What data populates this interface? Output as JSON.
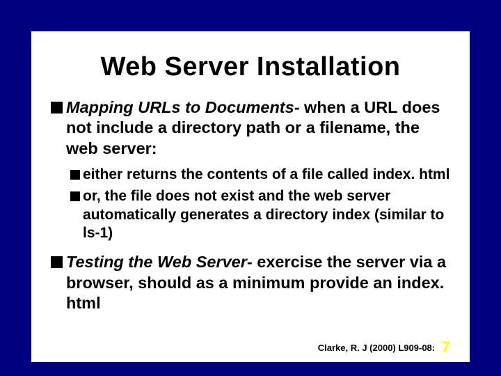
{
  "title": "Web Server Installation",
  "bullets": {
    "b1_emph": "Mapping URLs to Documents",
    "b1_rest": "- when a URL does not include a directory path or a filename, the web server:",
    "b1a": "either returns the contents of a file called index. html",
    "b1b": "or, the file does not exist and the web server automatically generates a directory index (similar to ls-1)",
    "b2_emph": "Testing the Web Server",
    "b2_rest": "- exercise the server via a browser, should as a minimum provide an index. html"
  },
  "footer": {
    "citation": "Clarke, R. J (2000) L909-08:",
    "page": "7"
  }
}
